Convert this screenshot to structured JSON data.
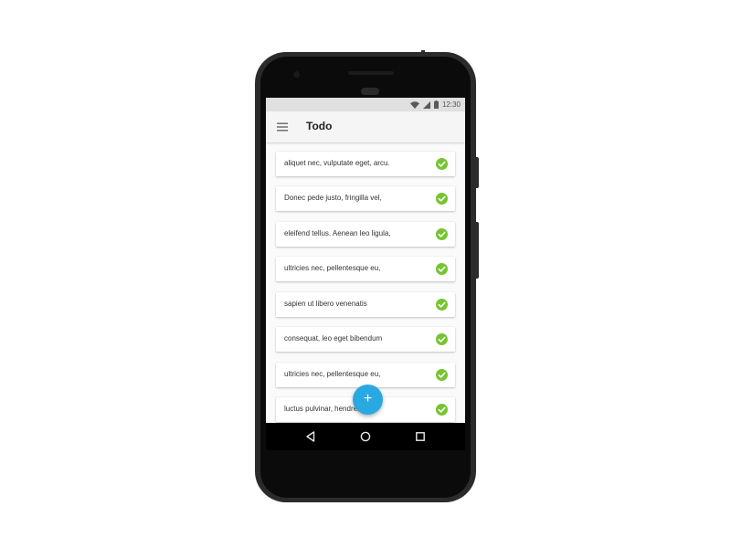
{
  "status_bar": {
    "time": "12:30",
    "icons": [
      "wifi-icon",
      "cell-signal-icon",
      "battery-icon"
    ]
  },
  "app_bar": {
    "menu_icon": "hamburger-menu-icon",
    "title": "Todo"
  },
  "todos": [
    {
      "text": "aliquet nec, vulputate eget, arcu.",
      "completed": true
    },
    {
      "text": "Donec pede justo, fringilla vel,",
      "completed": true
    },
    {
      "text": "eleifend tellus. Aenean leo ligula,",
      "completed": true
    },
    {
      "text": "ultricies nec, pellentesque eu,",
      "completed": true
    },
    {
      "text": "sapien ut libero venenatis",
      "completed": true
    },
    {
      "text": "consequat, leo eget bibendum",
      "completed": true
    },
    {
      "text": "ultricies nec, pellentesque eu,",
      "completed": true
    },
    {
      "text": "luctus pulvinar, hendrerit",
      "completed": true
    }
  ],
  "fab": {
    "icon": "plus-icon",
    "label": "+"
  },
  "nav_bar": {
    "buttons": [
      "back-icon",
      "home-icon",
      "recent-apps-icon"
    ]
  },
  "colors": {
    "accent": "#29a9e1",
    "check": "#76c530",
    "app_bar": "#f5f5f5",
    "status_bar": "#e0e0e0"
  }
}
